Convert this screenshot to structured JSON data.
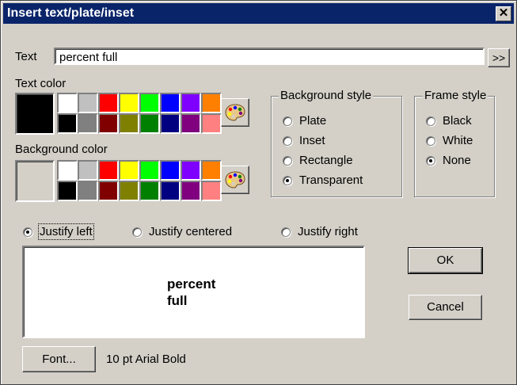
{
  "window": {
    "title": "Insert text/plate/inset",
    "close_glyph": "✕"
  },
  "text_row": {
    "label": "Text",
    "value": "percent full",
    "more_label": ">>"
  },
  "text_color": {
    "label": "Text color",
    "current": "#000000",
    "top_row": [
      "#ffffff",
      "#c0c0c0",
      "#ff0000",
      "#ffff00",
      "#00ff00",
      "#0000ff",
      "#8000ff",
      "#ff8000"
    ],
    "bottom_row": [
      "#000000",
      "#808080",
      "#800000",
      "#808000",
      "#008000",
      "#000080",
      "#800080",
      "#ff8080"
    ]
  },
  "background_color": {
    "label": "Background color",
    "current": "#d4d0c8",
    "top_row": [
      "#ffffff",
      "#c0c0c0",
      "#ff0000",
      "#ffff00",
      "#00ff00",
      "#0000ff",
      "#8000ff",
      "#ff8000"
    ],
    "bottom_row": [
      "#000000",
      "#808080",
      "#800000",
      "#808000",
      "#008000",
      "#000080",
      "#800080",
      "#ff8080"
    ]
  },
  "background_style": {
    "label": "Background style",
    "options": [
      "Plate",
      "Inset",
      "Rectangle",
      "Transparent"
    ],
    "selected": "Transparent"
  },
  "frame_style": {
    "label": "Frame style",
    "options": [
      "Black",
      "White",
      "None"
    ],
    "selected": "None"
  },
  "justify": {
    "options": [
      "Justify left",
      "Justify centered",
      "Justify right"
    ],
    "selected": "Justify left"
  },
  "preview": {
    "text": "percent\nfull"
  },
  "buttons": {
    "ok": "OK",
    "cancel": "Cancel",
    "font": "Font..."
  },
  "font_desc": "10 pt Arial Bold",
  "icons": {
    "palette": "palette-icon"
  }
}
